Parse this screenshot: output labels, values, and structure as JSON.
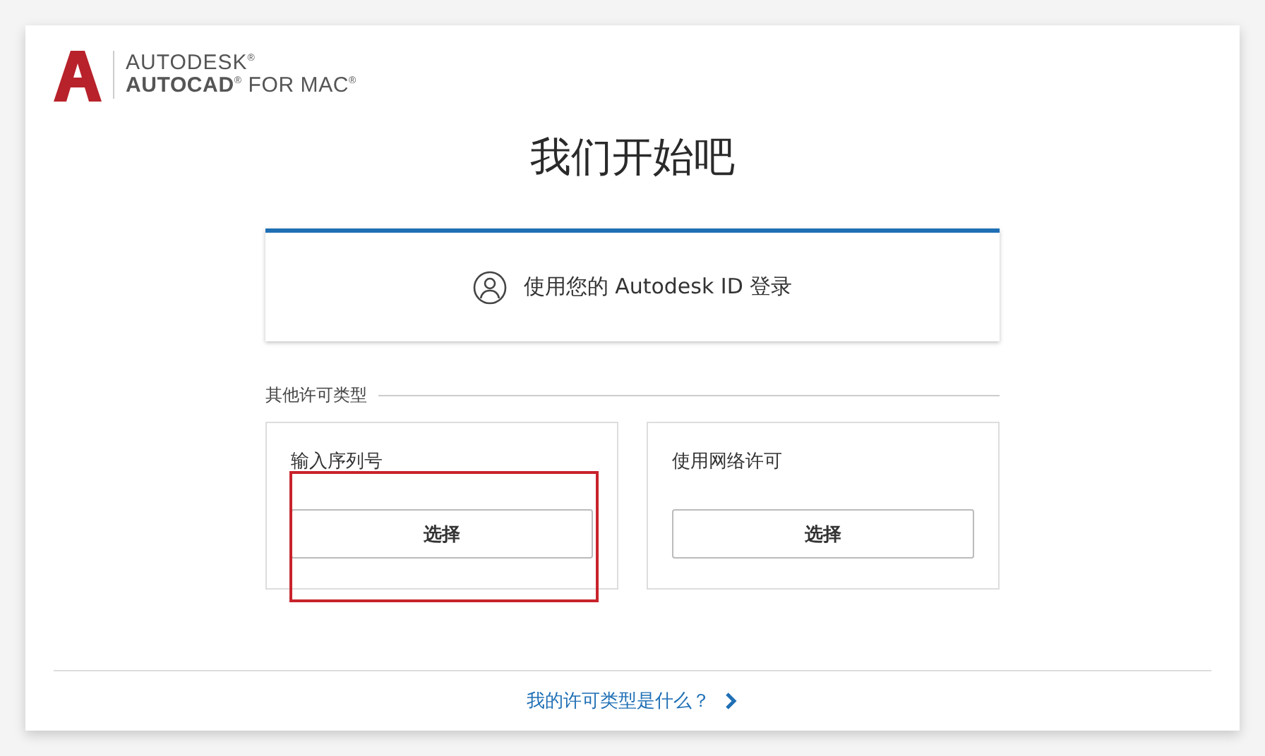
{
  "logo": {
    "brand": "AUTODESK$^{®}$",
    "product": "**AUTOCAD**$^{®}$ FOR MAC$^{®}$"
  },
  "title": "我们开始吧",
  "sign_in": {
    "label": "使用您的 Autodesk ID 登录"
  },
  "other_licenses": {
    "heading": "其他许可类型",
    "options": [
      {
        "title": "输入序列号",
        "button": "选择",
        "highlighted": true
      },
      {
        "title": "使用网络许可",
        "button": "选择",
        "highlighted": false
      }
    ]
  },
  "footer": {
    "link": "我的许可类型是什么？"
  }
}
